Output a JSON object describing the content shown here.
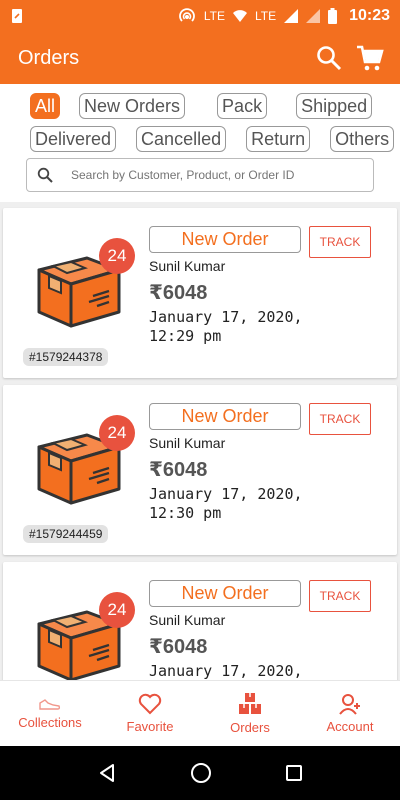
{
  "status_bar": {
    "time": "10:23",
    "lte1": "LTE",
    "lte2": "LTE"
  },
  "app_bar": {
    "title": "Orders"
  },
  "filters": {
    "row1": [
      "All",
      "New Orders",
      "Pack",
      "Shipped"
    ],
    "row2": [
      "Delivered",
      "Cancelled",
      "Return",
      "Others"
    ],
    "active": "All"
  },
  "search": {
    "placeholder": "Search by Customer, Product, or Order ID"
  },
  "orders": [
    {
      "badge": "24",
      "id": "#1579244378",
      "status": "New Order",
      "track": "TRACK",
      "customer": "Sunil Kumar",
      "amount": "₹6048",
      "date_line1": "January 17, 2020,",
      "date_line2": "12:29 pm"
    },
    {
      "badge": "24",
      "id": "#1579244459",
      "status": "New Order",
      "track": "TRACK",
      "customer": "Sunil Kumar",
      "amount": "₹6048",
      "date_line1": "January 17, 2020,",
      "date_line2": "12:30 pm"
    },
    {
      "badge": "24",
      "id": "",
      "status": "New Order",
      "track": "TRACK",
      "customer": "Sunil Kumar",
      "amount": "₹6048",
      "date_line1": "January 17, 2020,",
      "date_line2": ""
    }
  ],
  "bottom_nav": [
    {
      "label": "Collections",
      "icon": "shoe-icon"
    },
    {
      "label": "Favorite",
      "icon": "heart-icon"
    },
    {
      "label": "Orders",
      "icon": "boxes-icon"
    },
    {
      "label": "Account",
      "icon": "user-add-icon"
    }
  ],
  "colors": {
    "primary": "#f36f1f",
    "accent": "#e8523e"
  }
}
